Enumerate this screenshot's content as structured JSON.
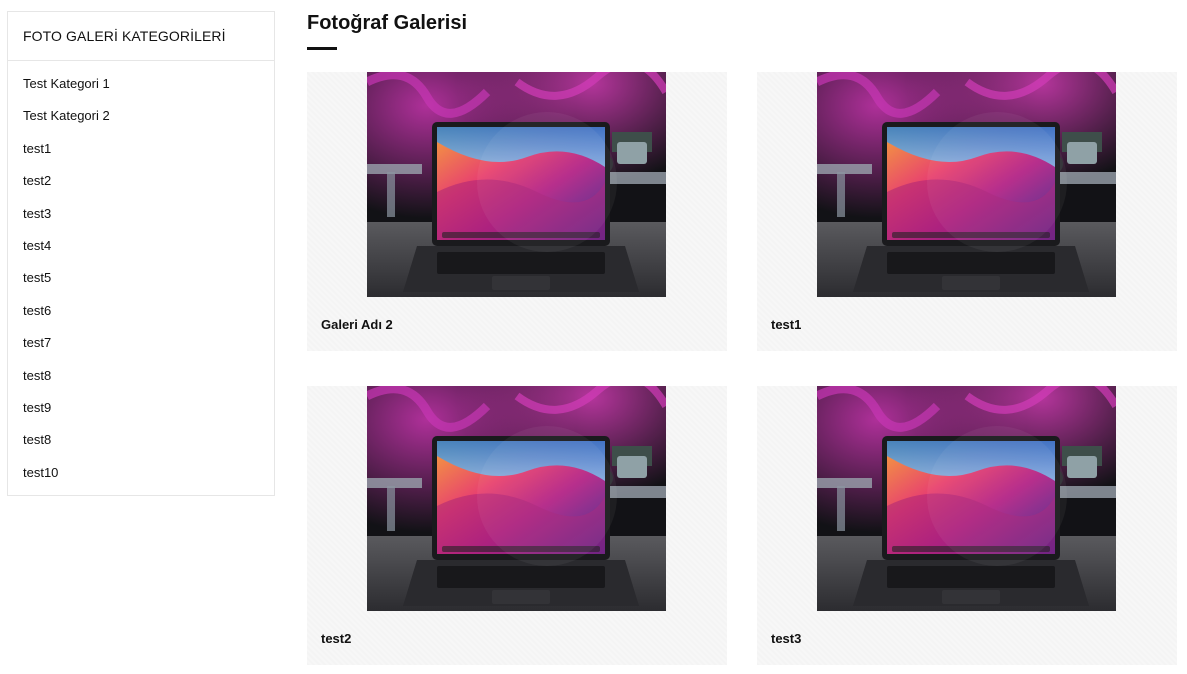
{
  "sidebar": {
    "heading": "FOTO GALERİ KATEGORİLERİ",
    "items": [
      {
        "label": "Test Kategori 1"
      },
      {
        "label": "Test Kategori 2"
      },
      {
        "label": "test1"
      },
      {
        "label": "test2"
      },
      {
        "label": "test3"
      },
      {
        "label": "test4"
      },
      {
        "label": "test5"
      },
      {
        "label": "test6"
      },
      {
        "label": "test7"
      },
      {
        "label": "test8"
      },
      {
        "label": "test9"
      },
      {
        "label": "test8"
      },
      {
        "label": "test10"
      }
    ]
  },
  "main": {
    "title": "Fotoğraf Galerisi",
    "galleries": [
      {
        "title": "Galeri Adı 2",
        "image": "laptop-photo"
      },
      {
        "title": "test1",
        "image": "laptop-photo"
      },
      {
        "title": "test2",
        "image": "laptop-photo"
      },
      {
        "title": "test3",
        "image": "laptop-photo"
      }
    ]
  },
  "colors": {
    "accent": "#111111",
    "card_background": "#f7f7f7",
    "border": "#e6e6e6"
  }
}
